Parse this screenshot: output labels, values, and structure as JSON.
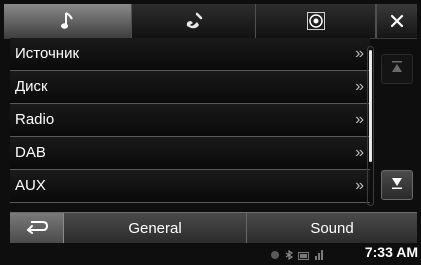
{
  "tabs": [
    {
      "icon": "music-note-icon",
      "active": true
    },
    {
      "icon": "phone-icon",
      "active": false
    },
    {
      "icon": "disc-settings-icon",
      "active": false
    },
    {
      "icon": "close-icon",
      "active": false
    }
  ],
  "menu": {
    "items": [
      {
        "label": "Источник",
        "chevron": "»"
      },
      {
        "label": "Диск",
        "chevron": "»"
      },
      {
        "label": "Radio",
        "chevron": "»"
      },
      {
        "label": "DAB",
        "chevron": "»"
      },
      {
        "label": "AUX",
        "chevron": "»"
      }
    ]
  },
  "bottom": {
    "general_label": "General",
    "sound_label": "Sound"
  },
  "status": {
    "time": "7:33 AM"
  }
}
